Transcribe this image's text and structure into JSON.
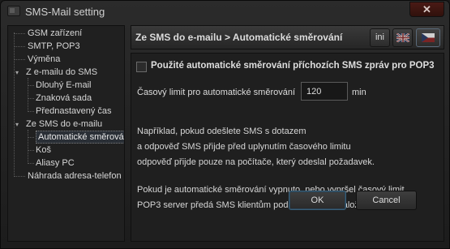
{
  "window": {
    "title": "SMS-Mail setting",
    "close_label": "✕"
  },
  "tree": {
    "items": [
      {
        "label": "GSM zařízení"
      },
      {
        "label": "SMTP, POP3"
      },
      {
        "label": "Výměna"
      },
      {
        "label": "Z e-mailu do SMS"
      },
      {
        "label": "Dlouhý E-mail"
      },
      {
        "label": "Znaková sada"
      },
      {
        "label": "Přednastavený čas"
      },
      {
        "label": "Ze SMS do e-mailu"
      },
      {
        "label": "Automatické směrová"
      },
      {
        "label": "Koš"
      },
      {
        "label": "Aliasy PC"
      },
      {
        "label": "Náhrada adresa-telefon"
      }
    ],
    "expander_icon": "▾"
  },
  "header": {
    "breadcrumb": "Ze SMS do e-mailu   >   Automatické směrování",
    "ini_label": "ini"
  },
  "content": {
    "checkbox_label": "Použité automatické směrování příchozích SMS zpráv pro POP3",
    "limit_label": "Časový limit pro automatické směrování",
    "limit_value": "120",
    "limit_unit": "min",
    "example_lines": [
      "Například, pokud odešlete SMS s dotazem",
      "a odpověď SMS přijde před uplynutím časového limitu",
      "odpověď přijde pouze na počítače, který odeslal požadavek."
    ],
    "note_lines": [
      "Pokud je automatické směrování vypnuto, nebo vypršel časový limit",
      "POP3 server předá SMS klientům podle pravidel v záložce Koš."
    ]
  },
  "buttons": {
    "ok_label": "OK",
    "cancel_label": "Cancel"
  }
}
